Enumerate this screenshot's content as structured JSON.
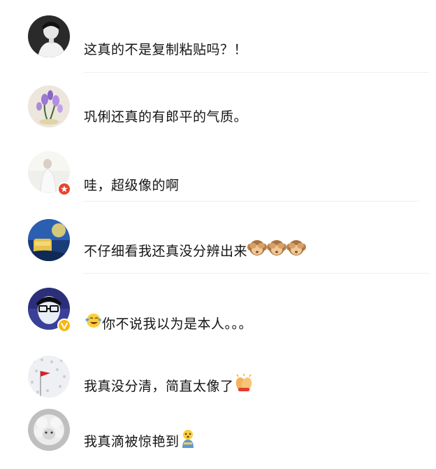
{
  "comments": [
    {
      "text": "这真的不是复制粘贴吗？！"
    },
    {
      "text": "巩俐还真的有郎平的气质。"
    },
    {
      "text": "哇，超级像的啊",
      "badge": "red-star-badge"
    },
    {
      "text": "不仔细看我还真没分辨出来",
      "trailing_emoji": [
        "see-no-evil-monkey",
        "see-no-evil-monkey",
        "see-no-evil-monkey"
      ]
    },
    {
      "text": "你不说我以为是本人。。。",
      "leading_emoji": "tears-of-joy-emoji",
      "badge": "gold-v-badge"
    },
    {
      "text": "我真没分清，简直太像了",
      "trailing_emoji": [
        "applause-hands"
      ]
    },
    {
      "text": "我真滴被惊艳到",
      "trailing_emoji": [
        "shocked-baby-emoji"
      ]
    }
  ],
  "colors": {
    "text": "#141414",
    "divider": "#efefef",
    "badge_red": "#e8432e",
    "badge_gold": "#f5b70d"
  }
}
